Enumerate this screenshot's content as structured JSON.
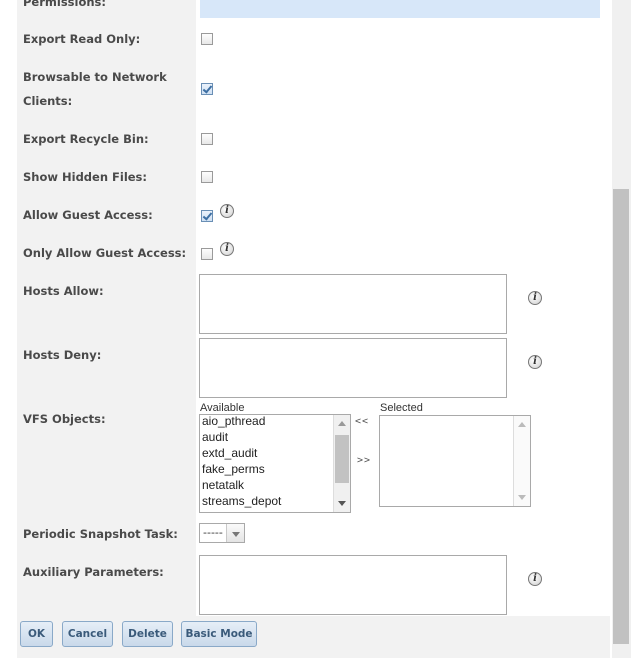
{
  "form": {
    "permissions_label": "Permissions:",
    "export_read_only_label": "Export Read Only:",
    "browsable_label_line1": "Browsable to Network",
    "browsable_label_line2": "Clients:",
    "export_recycle_bin_label": "Export Recycle Bin:",
    "show_hidden_files_label": "Show Hidden Files:",
    "allow_guest_access_label": "Allow Guest Access:",
    "only_allow_guest_access_label": "Only Allow Guest Access:",
    "hosts_allow_label": "Hosts Allow:",
    "hosts_deny_label": "Hosts Deny:",
    "vfs_objects_label": "VFS Objects:",
    "periodic_snapshot_label": "Periodic Snapshot Task:",
    "auxiliary_parameters_label": "Auxiliary Parameters:"
  },
  "checkboxes": {
    "export_read_only": false,
    "browsable": true,
    "export_recycle_bin": false,
    "show_hidden_files": false,
    "allow_guest_access": true,
    "only_allow_guest_access": false
  },
  "vfs": {
    "available_label": "Available",
    "selected_label": "Selected",
    "move_left": "<<",
    "move_right": ">>",
    "available_items": [
      "aio_pthread",
      "audit",
      "extd_audit",
      "fake_perms",
      "netatalk",
      "streams_depot"
    ],
    "selected_items": []
  },
  "snapshot": {
    "selected": "-----"
  },
  "info_icon_glyph": "i",
  "buttons": {
    "ok": "OK",
    "cancel": "Cancel",
    "delete": "Delete",
    "basic_mode": "Basic Mode"
  },
  "colors": {
    "label_bg": "#f2f2f2",
    "button_bg": "#c9d9ea",
    "permissions_bar": "#d7e7f9"
  }
}
